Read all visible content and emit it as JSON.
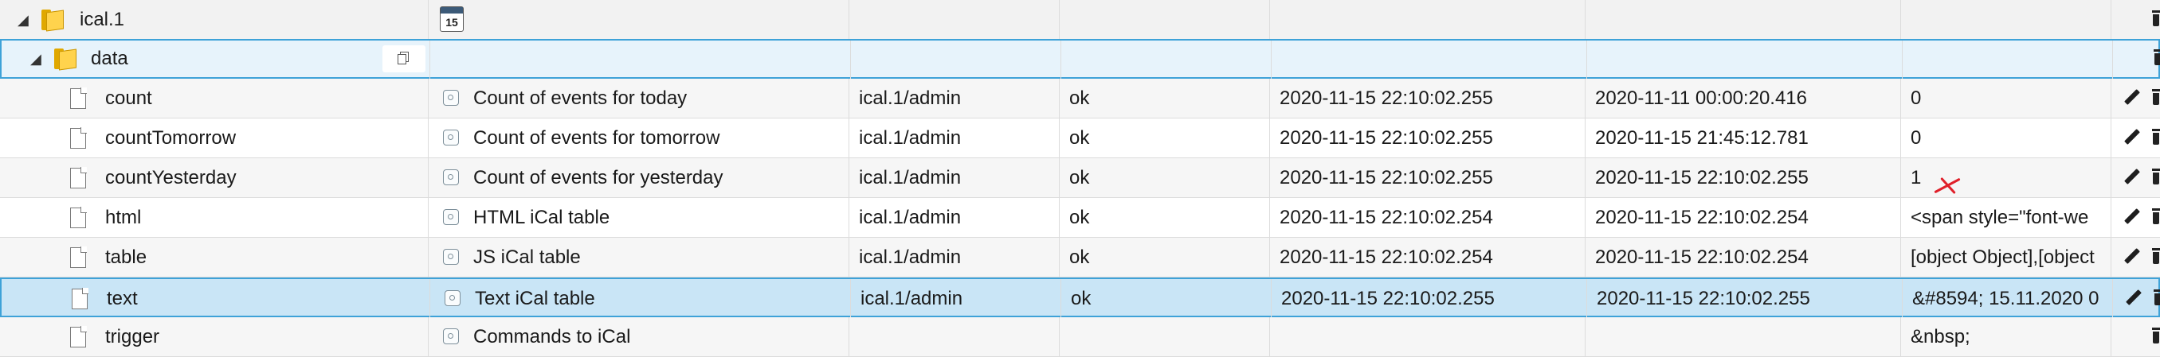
{
  "tree": {
    "root": {
      "label": "ical.1",
      "toggle": "◢",
      "icon": "folder-icon",
      "cell_icon": "calendar-icon",
      "calendar_day": "15"
    },
    "data_folder": {
      "label": "data",
      "toggle": "◢",
      "icon": "folder-icon",
      "action": "copy-icon"
    }
  },
  "columns": [
    "name",
    "description",
    "origin",
    "status",
    "timestamp",
    "last_change",
    "value",
    "actions"
  ],
  "rows": [
    {
      "name": "count",
      "description": "Count of events for today",
      "origin": "ical.1/admin",
      "status": "ok",
      "timestamp": "2020-11-15 22:10:02.255",
      "last_change": "2020-11-11 00:00:20.416",
      "value": "0"
    },
    {
      "name": "countTomorrow",
      "description": "Count of events for tomorrow",
      "origin": "ical.1/admin",
      "status": "ok",
      "timestamp": "2020-11-15 22:10:02.255",
      "last_change": "2020-11-15 21:45:12.781",
      "value": "0"
    },
    {
      "name": "countYesterday",
      "description": "Count of events for yesterday",
      "origin": "ical.1/admin",
      "status": "ok",
      "timestamp": "2020-11-15 22:10:02.255",
      "last_change": "2020-11-15 22:10:02.255",
      "value": "1"
    },
    {
      "name": "html",
      "description": "HTML iCal table",
      "origin": "ical.1/admin",
      "status": "ok",
      "timestamp": "2020-11-15 22:10:02.254",
      "last_change": "2020-11-15 22:10:02.254",
      "value": "<span style=\"font-we"
    },
    {
      "name": "table",
      "description": "JS iCal table",
      "origin": "ical.1/admin",
      "status": "ok",
      "timestamp": "2020-11-15 22:10:02.254",
      "last_change": "2020-11-15 22:10:02.254",
      "value": "[object Object],[object"
    },
    {
      "name": "text",
      "description": "Text iCal table",
      "origin": "ical.1/admin",
      "status": "ok",
      "timestamp": "2020-11-15 22:10:02.255",
      "last_change": "2020-11-15 22:10:02.255",
      "value": "&#8594; 15.11.2020 0"
    },
    {
      "name": "trigger",
      "description": "Commands to iCal",
      "origin": "",
      "status": "",
      "timestamp": "",
      "last_change": "",
      "value": "&nbsp;"
    }
  ],
  "icons": {
    "state": "state-icon",
    "edit": "pencil-icon",
    "delete": "trash-icon",
    "annotation": "red-x-mark"
  },
  "colors": {
    "selection_border": "#3ea2d8",
    "selection_fill": "#c9e5f6",
    "annotation": "#e0202a"
  }
}
